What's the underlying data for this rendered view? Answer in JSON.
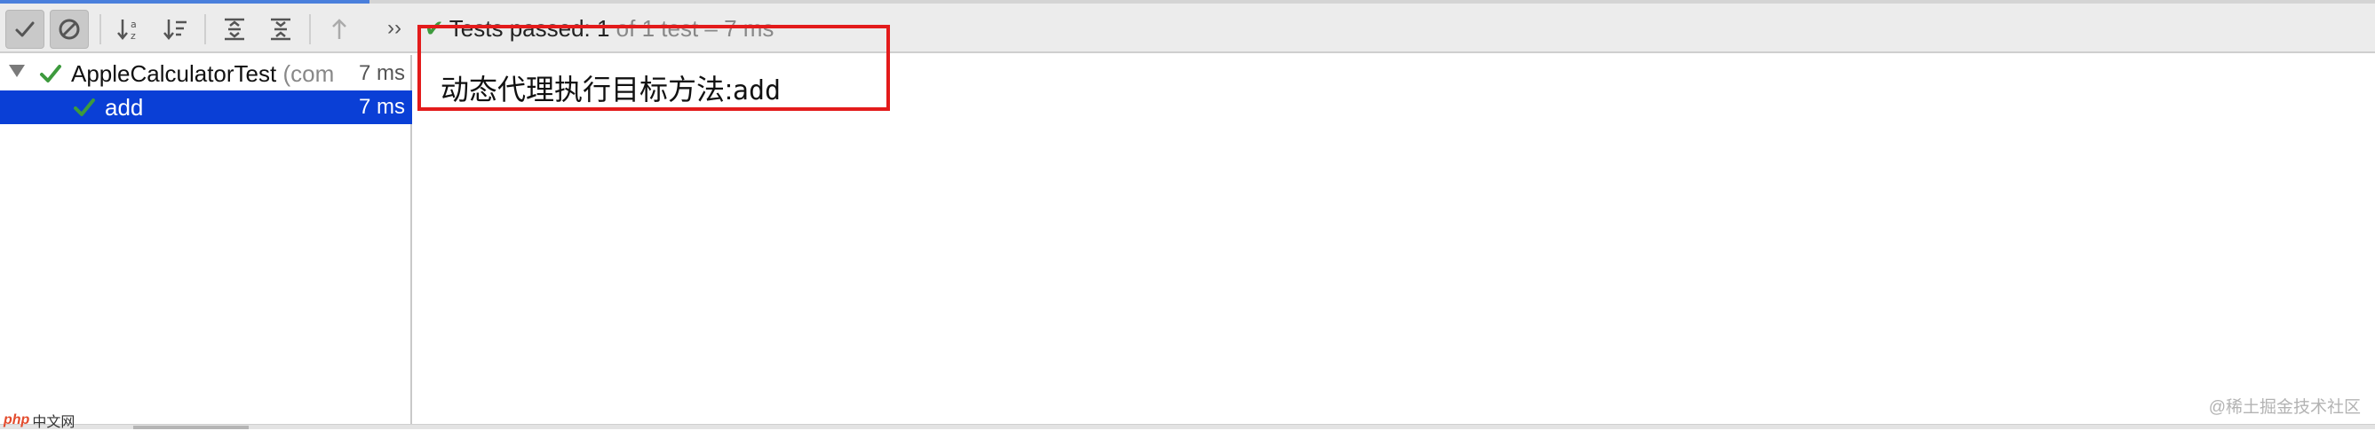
{
  "toolbar": {
    "buttons": [
      {
        "name": "show-passed-icon"
      },
      {
        "name": "show-ignored-icon"
      },
      {
        "name": "sort-alphabetically-icon"
      },
      {
        "name": "sort-by-duration-icon"
      },
      {
        "name": "expand-all-icon"
      },
      {
        "name": "collapse-all-icon"
      },
      {
        "name": "previous-failed-icon"
      }
    ],
    "more": "››",
    "status_passed": "Tests passed: 1",
    "status_rest": " of 1 test – 7 ms"
  },
  "tree": {
    "root": {
      "label": "AppleCalculatorTest",
      "suffix": " (com",
      "time": "7 ms"
    },
    "child": {
      "label": "add",
      "time": "7 ms"
    }
  },
  "console": {
    "text_cn": "动态代理执行目标方法:",
    "text_mono": "add"
  },
  "watermark": {
    "left_logo": "php",
    "left_text": "中文网",
    "right_text": "@稀土掘金技术社区"
  },
  "colors": {
    "selection": "#0a3fd6",
    "success": "#3d9a3d",
    "highlight": "#e31b1b"
  }
}
